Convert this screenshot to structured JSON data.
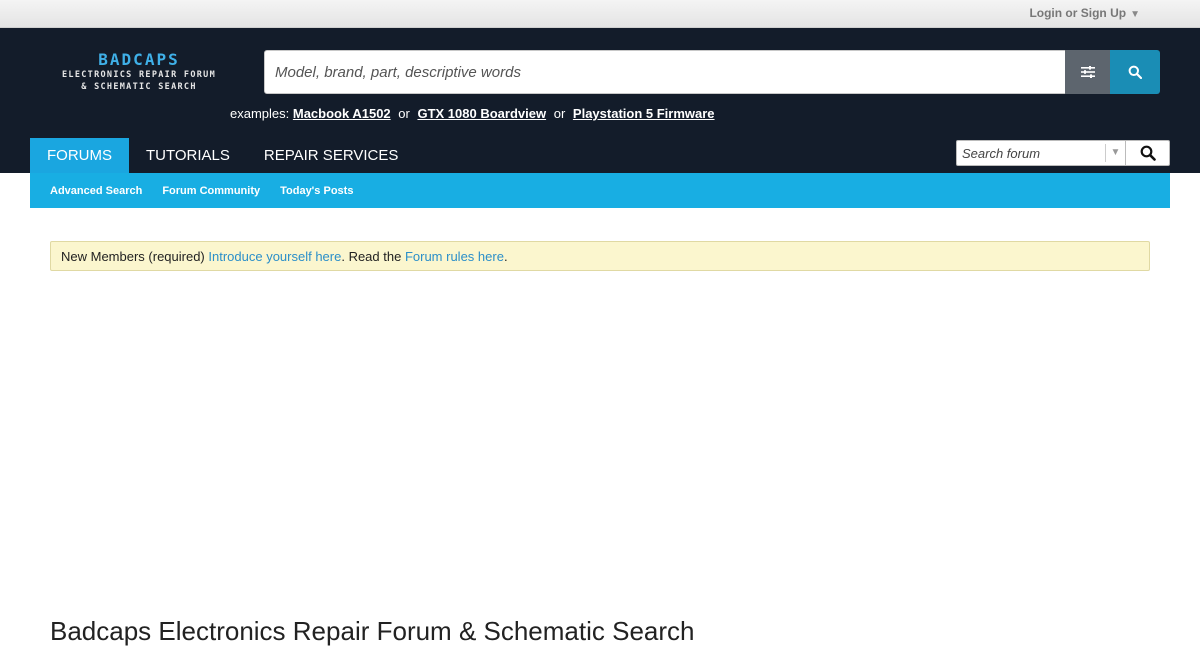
{
  "topbar": {
    "login_label": "Login or Sign Up",
    "caret": "▼"
  },
  "logo": {
    "brand": "BADCAPS",
    "line1": "ELECTRONICS REPAIR FORUM",
    "line2": "& SCHEMATIC SEARCH"
  },
  "main_search": {
    "placeholder": "Model, brand, part, descriptive words"
  },
  "examples": {
    "prefix": "examples:",
    "separator": "or",
    "items": [
      "Macbook A1502",
      "GTX 1080 Boardview",
      "Playstation 5 Firmware"
    ]
  },
  "nav": {
    "tabs": [
      "FORUMS",
      "TUTORIALS",
      "REPAIR SERVICES"
    ],
    "active": "FORUMS"
  },
  "forum_search": {
    "placeholder": "Search forum",
    "dropdown": "▼"
  },
  "subnav": {
    "links": [
      "Advanced Search",
      "Forum Community",
      "Today's Posts"
    ]
  },
  "notice": {
    "text1": "New Members (required) ",
    "link1": "Introduce yourself here",
    "text2": ". Read the ",
    "link2": "Forum rules here",
    "text3": "."
  },
  "page_title": "Badcaps Electronics Repair Forum & Schematic Search",
  "colors": {
    "header_bg": "#131c2a",
    "accent": "#1aa6e0",
    "search_btn": "#1a8db5",
    "notice_bg": "#fbf6ce",
    "link": "#2b8fc9"
  }
}
